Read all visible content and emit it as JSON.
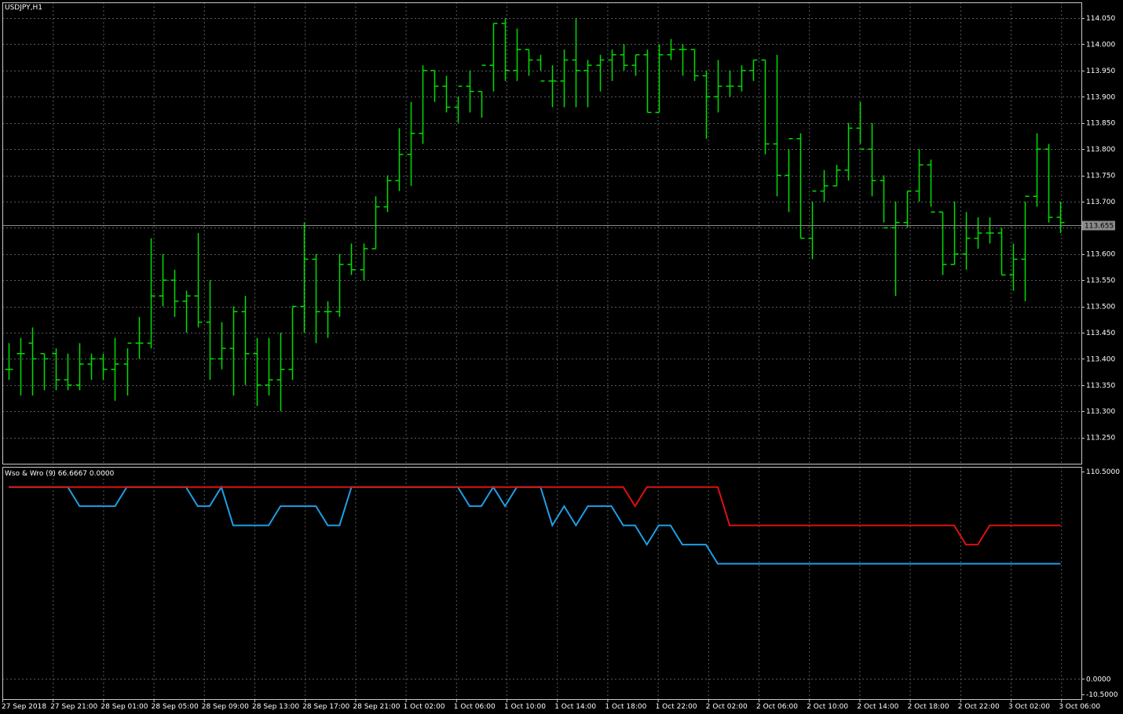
{
  "window": {
    "title": "USDJPY,H1"
  },
  "indicator": {
    "label": "Wso & Wro (9) 66.6667 0.0000"
  },
  "colors": {
    "background": "#000000",
    "grid": "#5a5a5a",
    "border": "#c8c8c8",
    "bars": "#00dd00",
    "wso_line": "#1e9fe6",
    "wro_line": "#dd1111",
    "price_line": "#8a8a8a",
    "price_badge": "#8a8a8a"
  },
  "chart_data": [
    {
      "type": "ohlc",
      "series_name": "USDJPY,H1",
      "current_price": 113.655,
      "current_price_label": "113.655",
      "ylim": [
        113.2,
        114.08
      ],
      "y_ticks": [
        "114.050",
        "114.000",
        "113.950",
        "113.900",
        "113.850",
        "113.800",
        "113.750",
        "113.700",
        "113.650",
        "113.600",
        "113.550",
        "113.500",
        "113.450",
        "113.400",
        "113.350",
        "113.300",
        "113.250"
      ],
      "x_ticks": [
        "27 Sep 2018",
        "27 Sep 21:00",
        "28 Sep 01:00",
        "28 Sep 05:00",
        "28 Sep 09:00",
        "28 Sep 13:00",
        "28 Sep 17:00",
        "28 Sep 21:00",
        "1 Oct 02:00",
        "1 Oct 06:00",
        "1 Oct 10:00",
        "1 Oct 14:00",
        "1 Oct 18:00",
        "1 Oct 22:00",
        "2 Oct 02:00",
        "2 Oct 06:00",
        "2 Oct 10:00",
        "2 Oct 14:00",
        "2 Oct 18:00",
        "2 Oct 22:00",
        "3 Oct 02:00",
        "3 Oct 06:00"
      ],
      "ohlc": [
        [
          113.38,
          113.43,
          113.36,
          113.38
        ],
        [
          113.41,
          113.44,
          113.33,
          113.41
        ],
        [
          113.43,
          113.46,
          113.33,
          113.4
        ],
        [
          113.41,
          113.41,
          113.34,
          113.4
        ],
        [
          113.41,
          113.42,
          113.34,
          113.36
        ],
        [
          113.36,
          113.41,
          113.34,
          113.35
        ],
        [
          113.35,
          113.43,
          113.34,
          113.39
        ],
        [
          113.39,
          113.41,
          113.36,
          113.4
        ],
        [
          113.4,
          113.41,
          113.36,
          113.38
        ],
        [
          113.38,
          113.44,
          113.32,
          113.39
        ],
        [
          113.39,
          113.42,
          113.33,
          113.43
        ],
        [
          113.43,
          113.48,
          113.4,
          113.43
        ],
        [
          113.43,
          113.63,
          113.42,
          113.52
        ],
        [
          113.52,
          113.6,
          113.5,
          113.55
        ],
        [
          113.55,
          113.57,
          113.48,
          113.51
        ],
        [
          113.51,
          113.53,
          113.45,
          113.52
        ],
        [
          113.52,
          113.64,
          113.46,
          113.47
        ],
        [
          113.47,
          113.55,
          113.36,
          113.4
        ],
        [
          113.4,
          113.47,
          113.38,
          113.42
        ],
        [
          113.42,
          113.5,
          113.33,
          113.49
        ],
        [
          113.49,
          113.52,
          113.35,
          113.41
        ],
        [
          113.41,
          113.44,
          113.31,
          113.35
        ],
        [
          113.35,
          113.44,
          113.33,
          113.36
        ],
        [
          113.36,
          113.45,
          113.3,
          113.38
        ],
        [
          113.38,
          113.5,
          113.36,
          113.5
        ],
        [
          113.5,
          113.66,
          113.45,
          113.59
        ],
        [
          113.59,
          113.6,
          113.43,
          113.49
        ],
        [
          113.49,
          113.51,
          113.44,
          113.49
        ],
        [
          113.49,
          113.6,
          113.48,
          113.58
        ],
        [
          113.58,
          113.62,
          113.56,
          113.57
        ],
        [
          113.57,
          113.62,
          113.55,
          113.61
        ],
        [
          113.61,
          113.71,
          113.61,
          113.69
        ],
        [
          113.69,
          113.75,
          113.68,
          113.74
        ],
        [
          113.74,
          113.84,
          113.72,
          113.79
        ],
        [
          113.79,
          113.89,
          113.73,
          113.83
        ],
        [
          113.83,
          113.96,
          113.81,
          113.95
        ],
        [
          113.95,
          113.95,
          113.89,
          113.92
        ],
        [
          113.92,
          113.94,
          113.87,
          113.88
        ],
        [
          113.88,
          113.9,
          113.85,
          113.92
        ],
        [
          113.92,
          113.95,
          113.87,
          113.91
        ],
        [
          113.91,
          113.91,
          113.86,
          113.96
        ],
        [
          113.96,
          114.04,
          113.91,
          114.04
        ],
        [
          114.04,
          114.05,
          113.93,
          113.95
        ],
        [
          113.95,
          114.03,
          113.93,
          113.99
        ],
        [
          113.99,
          113.99,
          113.94,
          113.97
        ],
        [
          113.97,
          113.98,
          113.95,
          113.93
        ],
        [
          113.93,
          113.96,
          113.88,
          113.93
        ],
        [
          113.93,
          113.99,
          113.88,
          113.97
        ],
        [
          113.97,
          114.05,
          113.88,
          113.95
        ],
        [
          113.95,
          113.97,
          113.88,
          113.96
        ],
        [
          113.96,
          113.98,
          113.91,
          113.97
        ],
        [
          113.97,
          113.99,
          113.93,
          113.98
        ],
        [
          113.98,
          114.0,
          113.95,
          113.96
        ],
        [
          113.96,
          113.98,
          113.94,
          113.98
        ],
        [
          113.98,
          113.99,
          113.87,
          113.87
        ],
        [
          113.87,
          114.0,
          113.87,
          113.98
        ],
        [
          113.98,
          114.01,
          113.97,
          113.99
        ],
        [
          113.99,
          114.0,
          113.94,
          113.99
        ],
        [
          113.99,
          113.99,
          113.93,
          113.94
        ],
        [
          113.94,
          113.95,
          113.82,
          113.9
        ],
        [
          113.9,
          113.97,
          113.87,
          113.92
        ],
        [
          113.92,
          113.95,
          113.9,
          113.92
        ],
        [
          113.92,
          113.96,
          113.91,
          113.95
        ],
        [
          113.95,
          113.97,
          113.93,
          113.97
        ],
        [
          113.97,
          113.97,
          113.79,
          113.81
        ],
        [
          113.81,
          113.98,
          113.71,
          113.75
        ],
        [
          113.75,
          113.8,
          113.68,
          113.82
        ],
        [
          113.82,
          113.83,
          113.63,
          113.63
        ],
        [
          113.63,
          113.7,
          113.59,
          113.72
        ],
        [
          113.72,
          113.76,
          113.7,
          113.73
        ],
        [
          113.73,
          113.77,
          113.73,
          113.76
        ],
        [
          113.76,
          113.85,
          113.74,
          113.84
        ],
        [
          113.84,
          113.89,
          113.81,
          113.8
        ],
        [
          113.8,
          113.85,
          113.71,
          113.74
        ],
        [
          113.74,
          113.75,
          113.66,
          113.65
        ],
        [
          113.65,
          113.7,
          113.52,
          113.66
        ],
        [
          113.66,
          113.72,
          113.65,
          113.72
        ],
        [
          113.72,
          113.8,
          113.7,
          113.77
        ],
        [
          113.77,
          113.78,
          113.69,
          113.68
        ],
        [
          113.68,
          113.68,
          113.56,
          113.58
        ],
        [
          113.58,
          113.7,
          113.58,
          113.6
        ],
        [
          113.6,
          113.68,
          113.57,
          113.63
        ],
        [
          113.63,
          113.67,
          113.61,
          113.64
        ],
        [
          113.64,
          113.67,
          113.62,
          113.64
        ],
        [
          113.64,
          113.65,
          113.56,
          113.56
        ],
        [
          113.56,
          113.62,
          113.53,
          113.59
        ],
        [
          113.59,
          113.7,
          113.51,
          113.71
        ],
        [
          113.71,
          113.83,
          113.69,
          113.8
        ],
        [
          113.8,
          113.81,
          113.66,
          113.67
        ],
        [
          113.67,
          113.7,
          113.64,
          113.66
        ]
      ]
    },
    {
      "type": "line",
      "title": "Wso & Wro (9) 66.6667 0.0000",
      "ylim": [
        -10.5,
        110.5
      ],
      "y_ticks": [
        "110.5000",
        "0.0000",
        "-10.5000"
      ],
      "series": [
        {
          "color": "#1e9fe6",
          "values": [
            100,
            100,
            100,
            100,
            100,
            100,
            90,
            90,
            90,
            90,
            100,
            100,
            100,
            100,
            100,
            100,
            90,
            90,
            100,
            80,
            80,
            80,
            80,
            90,
            90,
            90,
            90,
            80,
            80,
            100,
            100,
            100,
            100,
            100,
            100,
            100,
            100,
            100,
            100,
            90,
            90,
            100,
            90,
            100,
            100,
            100,
            80,
            90,
            80,
            90,
            90,
            90,
            80,
            80,
            70,
            80,
            80,
            70,
            70,
            70,
            60,
            60,
            60,
            60,
            60,
            60,
            60,
            60,
            60,
            60,
            60,
            60,
            60,
            60,
            60,
            60,
            60,
            60,
            60,
            60,
            60,
            60,
            60,
            60,
            60,
            60,
            60,
            60,
            60,
            60
          ]
        },
        {
          "color": "#dd1111",
          "values": [
            100,
            100,
            100,
            100,
            100,
            100,
            100,
            100,
            100,
            100,
            100,
            100,
            100,
            100,
            100,
            100,
            100,
            100,
            100,
            100,
            100,
            100,
            100,
            100,
            100,
            100,
            100,
            100,
            100,
            100,
            100,
            100,
            100,
            100,
            100,
            100,
            100,
            100,
            100,
            100,
            100,
            100,
            100,
            100,
            100,
            100,
            100,
            100,
            100,
            100,
            100,
            100,
            100,
            90,
            100,
            100,
            100,
            100,
            100,
            100,
            100,
            80,
            80,
            80,
            80,
            80,
            80,
            80,
            80,
            80,
            80,
            80,
            80,
            80,
            80,
            80,
            80,
            80,
            80,
            80,
            80,
            70,
            70,
            80,
            80,
            80,
            80,
            80,
            80,
            80
          ]
        }
      ]
    }
  ]
}
